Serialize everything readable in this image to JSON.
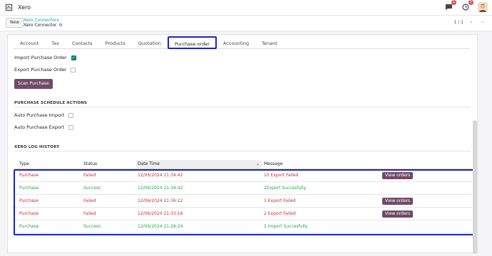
{
  "app": {
    "title": "Xero"
  },
  "navbar": {
    "chat_badge": "1",
    "activity_badge": "1"
  },
  "control": {
    "new_label": "New",
    "breadcrumb_parent": "Xero Connectors",
    "breadcrumb_current": "Xero Connector",
    "pager": "1 / 1"
  },
  "tabs": [
    "Account",
    "Tax",
    "Contacts",
    "Products",
    "Quotation",
    "Purchase order",
    "Accounting",
    "Tenant"
  ],
  "active_tab": "Purchase order",
  "fields": {
    "import_purchase_order": {
      "label": "Import Purchase Order",
      "checked": true
    },
    "export_purchase_order": {
      "label": "Export Purchase Order",
      "checked": false
    },
    "scan_purchase_label": "Scan Purchase"
  },
  "schedule": {
    "title": "PURCHASE SCHEDULE ACTIONS",
    "auto_import": {
      "label": "Auto Purchase Import",
      "checked": false
    },
    "auto_export": {
      "label": "Auto Purchase Export",
      "checked": false
    }
  },
  "log": {
    "title": "XERO LOG HISTORY",
    "columns": [
      "Type",
      "Status",
      "Date Time",
      "Message"
    ],
    "view_label": "View orders",
    "rows": [
      {
        "type": "Purchase",
        "status": "Failed",
        "datetime": "12/06/2024 21:34:42",
        "message": "10 Export Failed",
        "has_view": true,
        "color": "#c9302c"
      },
      {
        "type": "Purchase",
        "status": "Success",
        "datetime": "12/06/2024 21:34:42",
        "message": "2Export Succesfully",
        "has_view": false,
        "color": "#28a745"
      },
      {
        "type": "Purchase",
        "status": "Failed",
        "datetime": "12/06/2024 21:36:22",
        "message": "1 Export Failed",
        "has_view": true,
        "color": "#c9302c"
      },
      {
        "type": "Purchase",
        "status": "Failed",
        "datetime": "12/06/2024 21:33:16",
        "message": "2 Export Failed",
        "has_view": true,
        "color": "#c9302c"
      },
      {
        "type": "Purchase",
        "status": "Success",
        "datetime": "12/06/2024 21:28:24",
        "message": "2 Import Succesfully",
        "has_view": false,
        "color": "#28a745"
      }
    ]
  },
  "colors": {
    "accent": "#714b67",
    "highlight": "#1b28a8",
    "teal": "#017e84",
    "link": "#17a2b8"
  }
}
